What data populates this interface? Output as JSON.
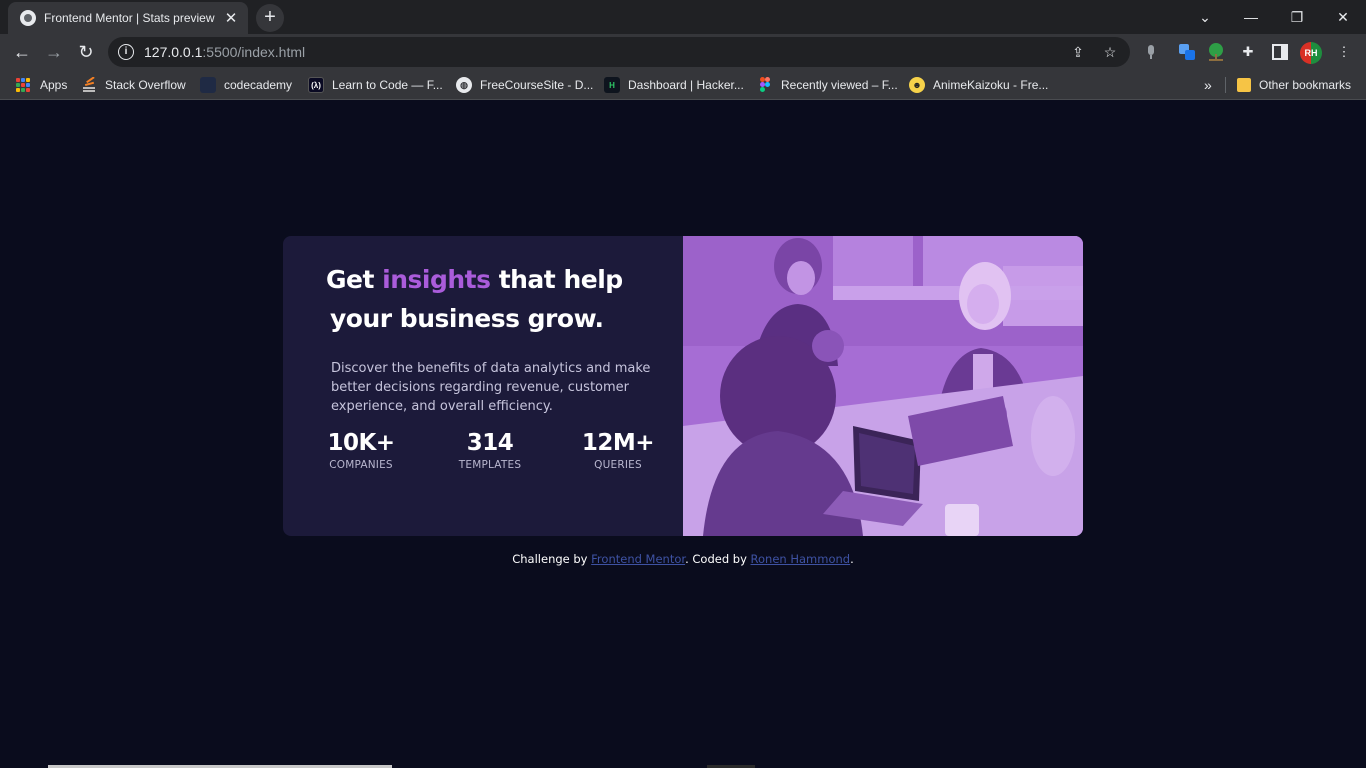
{
  "browser": {
    "tab_title": "Frontend Mentor | Stats preview",
    "tab_close": "✕",
    "new_tab": "+",
    "url_host": "127.0.0.1",
    "url_rest": ":5500/index.html",
    "avatar_initials": "RH",
    "bookmarks": [
      {
        "label": "Apps",
        "icon": "apps-grid-icon"
      },
      {
        "label": "Stack Overflow",
        "icon": "stackoverflow-icon"
      },
      {
        "label": "codecademy",
        "icon": "codecademy-icon"
      },
      {
        "label": "Learn to Code — F...",
        "icon": "freecodecamp-icon"
      },
      {
        "label": "FreeCourseSite - D...",
        "icon": "globe-icon"
      },
      {
        "label": "Dashboard | Hacker...",
        "icon": "hackerrank-icon"
      },
      {
        "label": "Recently viewed – F...",
        "icon": "figma-icon"
      },
      {
        "label": "AnimeKaizoku - Fre...",
        "icon": "anime-icon"
      }
    ],
    "overflow": "»",
    "other_bookmarks": "Other bookmarks"
  },
  "card": {
    "headline_pre": "Get ",
    "headline_accent": "insights",
    "headline_post": " that help",
    "headline_line2": "your business grow.",
    "description": "Discover the benefits of data analytics and make better decisions regarding revenue, customer experience, and overall efficiency.",
    "stats": [
      {
        "value": "10K+",
        "label": "COMPANIES"
      },
      {
        "value": "314",
        "label": "TEMPLATES"
      },
      {
        "value": "12M+",
        "label": "QUERIES"
      }
    ]
  },
  "footer": {
    "prefix": "Challenge by ",
    "link1": "Frontend Mentor",
    "middle": ". Coded by ",
    "link2": "Ronen Hammond",
    "suffix": "."
  },
  "colors": {
    "page_bg": "#0a0c1d",
    "card_bg": "#1c1a3a",
    "accent": "#aa5cdb",
    "image_overlay": "#a56bd3",
    "link": "#3e52a3"
  }
}
